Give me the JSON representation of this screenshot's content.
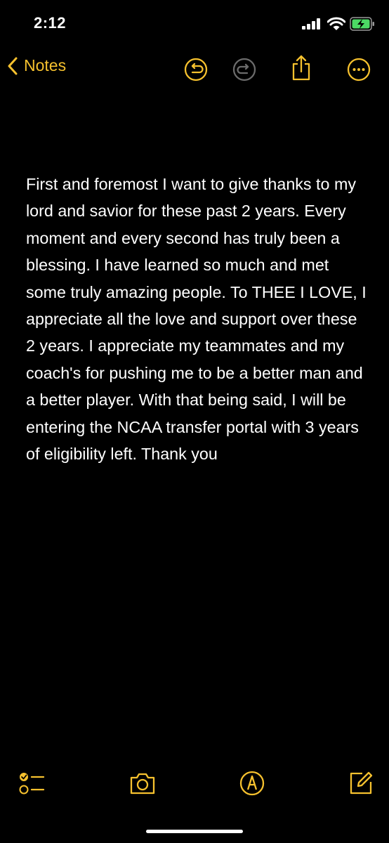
{
  "status": {
    "time": "2:12"
  },
  "nav": {
    "back_label": "Notes"
  },
  "note": {
    "text": "First and foremost I want to give thanks to my lord and savior for these past 2 years. Every moment and every second has truly been a blessing. I have learned so much and met some truly amazing people. To THEE I LOVE, I appreciate all the love and support over these 2 years. I appreciate my teammates and my coach's for pushing me to be a better man and a better player. With that being said, I will be entering the NCAA transfer portal with 3 years of eligibility left. Thank you"
  },
  "colors": {
    "accent": "#f6c12e",
    "background": "#000000",
    "text": "#ffffff",
    "disabled": "#6b6b6b"
  },
  "icons": {
    "nav": [
      "chevron-left-icon",
      "undo-icon",
      "redo-icon",
      "share-icon",
      "more-icon"
    ],
    "toolbar": [
      "checklist-icon",
      "camera-icon",
      "markup-icon",
      "compose-icon"
    ]
  }
}
